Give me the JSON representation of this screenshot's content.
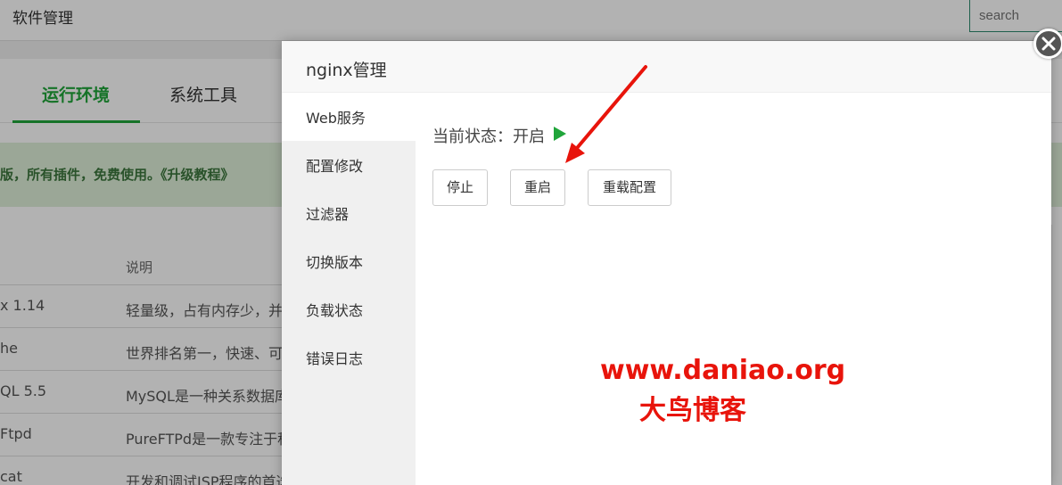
{
  "background": {
    "title": "软件管理",
    "search_placeholder": "search",
    "tabs": [
      {
        "label": "运行环境",
        "active": true
      },
      {
        "label": "系统工具",
        "active": false
      }
    ],
    "banner": "版，所有插件，免费使用。《升级教程》",
    "table": {
      "desc_header": "说明",
      "rows": [
        {
          "name": "x 1.14",
          "desc": "轻量级，占有内存少，并"
        },
        {
          "name": "he",
          "desc": "世界排名第一，快速、可"
        },
        {
          "name": "QL 5.5",
          "desc": "MySQL是一种关系数据库"
        },
        {
          "name": "Ftpd",
          "desc": "PureFTPd是一款专注于程"
        },
        {
          "name": "cat",
          "desc": "开发和调试JSP程序的首选"
        }
      ]
    }
  },
  "modal": {
    "title": "nginx管理",
    "nav": [
      {
        "label": "Web服务",
        "active": true
      },
      {
        "label": "配置修改",
        "active": false
      },
      {
        "label": "过滤器",
        "active": false
      },
      {
        "label": "切换版本",
        "active": false
      },
      {
        "label": "负载状态",
        "active": false
      },
      {
        "label": "错误日志",
        "active": false
      }
    ],
    "status_label": "当前状态：开启",
    "status_color": "#20a53a",
    "buttons": {
      "stop": "停止",
      "restart": "重启",
      "reload": "重载配置"
    },
    "close_icon": "close-icon"
  },
  "watermark": {
    "url": "www.daniao.org",
    "name": "大鸟博客",
    "color": "#e8140b"
  }
}
